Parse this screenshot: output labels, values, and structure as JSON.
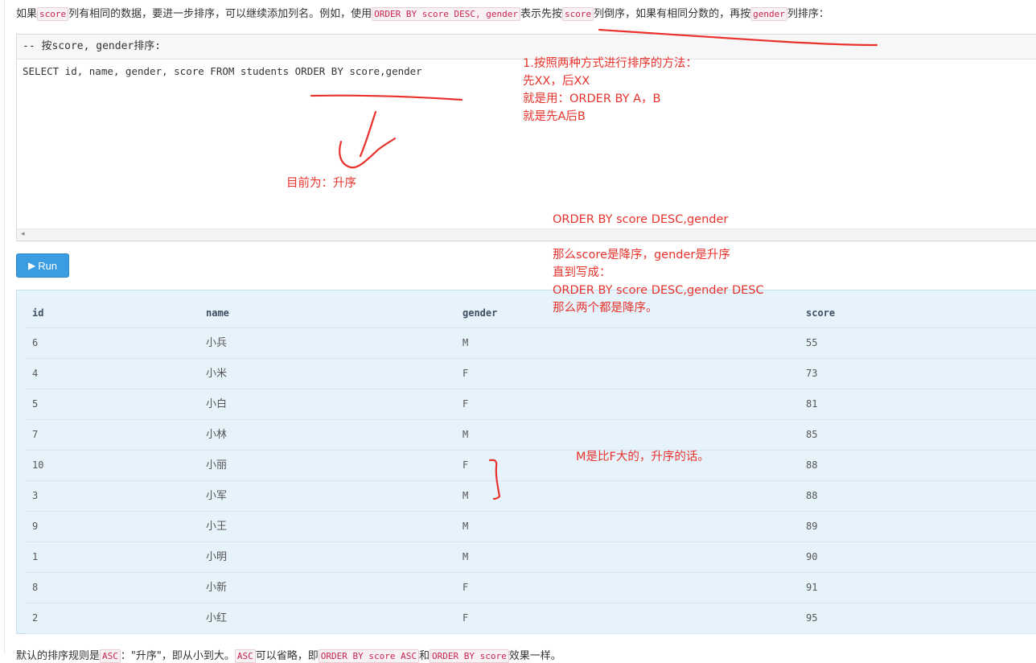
{
  "intro": {
    "p1": "如果",
    "c1": "score",
    "p2": "列有相同的数据，要进一步排序，可以继续添加列名。例如，使用",
    "c2": "ORDER BY score DESC, gender",
    "p3": "表示先按",
    "c3": "score",
    "p4": "列倒序，如果有相同分数的，再按",
    "c4": "gender",
    "p5": "列排序："
  },
  "editor": {
    "comment": "-- 按score, gender排序:",
    "code": "SELECT id, name, gender, score FROM students ORDER BY score,gender",
    "scroll_left": "◂"
  },
  "run_button": {
    "icon": "▶",
    "label": "Run"
  },
  "table": {
    "columns": [
      "id",
      "name",
      "gender",
      "score"
    ],
    "rows": [
      [
        "6",
        "小兵",
        "M",
        "55"
      ],
      [
        "4",
        "小米",
        "F",
        "73"
      ],
      [
        "5",
        "小白",
        "F",
        "81"
      ],
      [
        "7",
        "小林",
        "M",
        "85"
      ],
      [
        "10",
        "小丽",
        "F",
        "88"
      ],
      [
        "3",
        "小军",
        "M",
        "88"
      ],
      [
        "9",
        "小王",
        "M",
        "89"
      ],
      [
        "1",
        "小明",
        "M",
        "90"
      ],
      [
        "8",
        "小新",
        "F",
        "91"
      ],
      [
        "2",
        "小红",
        "F",
        "95"
      ]
    ]
  },
  "annotations": {
    "note1": [
      "1.按照两种方式进行排序的方法：",
      "先XX，后XX",
      "就是用：ORDER BY  A，B",
      "就是先A后B"
    ],
    "note2": "目前为：升序",
    "note3": [
      "ORDER BY score DESC,gender",
      "",
      "那么score是降序，gender是升序",
      "直到写成：",
      "ORDER BY score DESC,gender DESC",
      "那么两个都是降序。"
    ],
    "note4": "M是比F大的，升序的话。",
    "ink_color": "#e8322b"
  },
  "footer": {
    "p1": "默认的排序规则是",
    "c1": "ASC",
    "p2": "：\"升序\"，即从小到大。",
    "c2": "ASC",
    "p3": "可以省略，即",
    "c3": "ORDER BY score ASC",
    "p4": "和",
    "c4": "ORDER BY score",
    "p5": "效果一样。"
  }
}
